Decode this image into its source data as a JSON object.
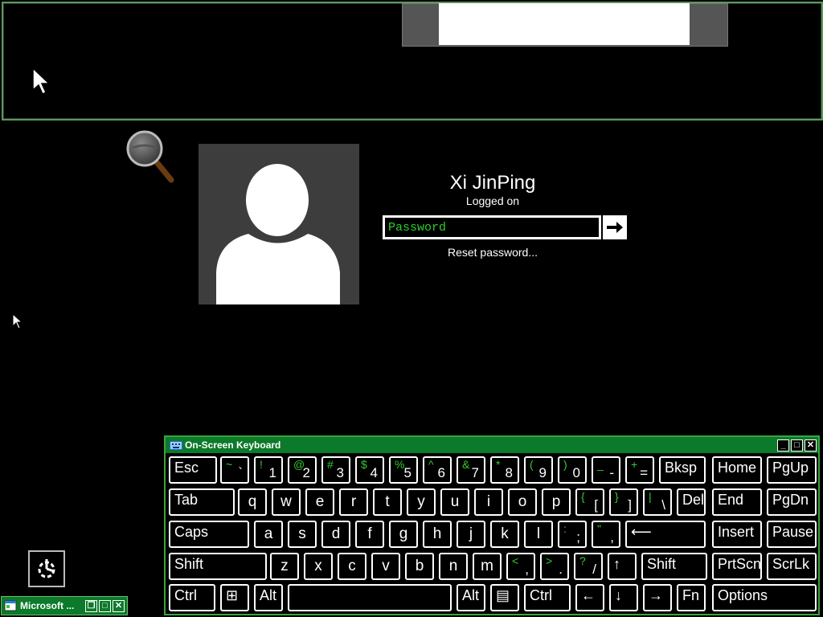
{
  "user": {
    "name": "Xi JinPing",
    "status": "Logged on",
    "password_placeholder": "Password",
    "reset_link": "Reset password..."
  },
  "osk": {
    "title": "On-Screen Keyboard",
    "rows": [
      [
        {
          "id": "esc",
          "label": "Esc"
        },
        {
          "id": "backtick",
          "shift": "~",
          "base": "`"
        },
        {
          "id": "1",
          "shift": "!",
          "base": "1"
        },
        {
          "id": "2",
          "shift": "@",
          "base": "2"
        },
        {
          "id": "3",
          "shift": "#",
          "base": "3"
        },
        {
          "id": "4",
          "shift": "$",
          "base": "4"
        },
        {
          "id": "5",
          "shift": "%",
          "base": "5"
        },
        {
          "id": "6",
          "shift": "^",
          "base": "6"
        },
        {
          "id": "7",
          "shift": "&",
          "base": "7"
        },
        {
          "id": "8",
          "shift": "*",
          "base": "8"
        },
        {
          "id": "9",
          "shift": "(",
          "base": "9"
        },
        {
          "id": "0",
          "shift": ")",
          "base": "0"
        },
        {
          "id": "minus",
          "shift": "_",
          "base": "-"
        },
        {
          "id": "equals",
          "shift": "+",
          "base": "="
        },
        {
          "id": "bksp",
          "label": "Bksp"
        },
        {
          "id": "home",
          "label": "Home"
        },
        {
          "id": "pgup",
          "label": "PgUp"
        }
      ],
      [
        {
          "id": "tab",
          "label": "Tab"
        },
        {
          "id": "q",
          "char": "q"
        },
        {
          "id": "w",
          "char": "w"
        },
        {
          "id": "e",
          "char": "e"
        },
        {
          "id": "r",
          "char": "r"
        },
        {
          "id": "t",
          "char": "t"
        },
        {
          "id": "y",
          "char": "y"
        },
        {
          "id": "u",
          "char": "u"
        },
        {
          "id": "i",
          "char": "i"
        },
        {
          "id": "o",
          "char": "o"
        },
        {
          "id": "p",
          "char": "p"
        },
        {
          "id": "lbracket",
          "shift": "{",
          "base": "["
        },
        {
          "id": "rbracket",
          "shift": "}",
          "base": "]"
        },
        {
          "id": "backslash",
          "shift": "|",
          "base": "\\"
        },
        {
          "id": "del",
          "label": "Del"
        },
        {
          "id": "end",
          "label": "End"
        },
        {
          "id": "pgdn",
          "label": "PgDn"
        }
      ],
      [
        {
          "id": "caps",
          "label": "Caps"
        },
        {
          "id": "a",
          "char": "a"
        },
        {
          "id": "s",
          "char": "s"
        },
        {
          "id": "d",
          "char": "d"
        },
        {
          "id": "f",
          "char": "f"
        },
        {
          "id": "g",
          "char": "g"
        },
        {
          "id": "h",
          "char": "h"
        },
        {
          "id": "j",
          "char": "j"
        },
        {
          "id": "k",
          "char": "k"
        },
        {
          "id": "l",
          "char": "l"
        },
        {
          "id": "semicolon",
          "shift": ":",
          "base": ";"
        },
        {
          "id": "quote",
          "shift": "\"",
          "base": ","
        },
        {
          "id": "enter",
          "label": "⟵"
        },
        {
          "id": "insert",
          "label": "Insert"
        },
        {
          "id": "pause",
          "label": "Pause"
        }
      ],
      [
        {
          "id": "lshift",
          "label": "Shift"
        },
        {
          "id": "z",
          "char": "z"
        },
        {
          "id": "x",
          "char": "x"
        },
        {
          "id": "c",
          "char": "c"
        },
        {
          "id": "v",
          "char": "v"
        },
        {
          "id": "b",
          "char": "b"
        },
        {
          "id": "n",
          "char": "n"
        },
        {
          "id": "m",
          "char": "m"
        },
        {
          "id": "comma",
          "shift": "<",
          "base": ","
        },
        {
          "id": "period",
          "shift": ">",
          "base": "."
        },
        {
          "id": "slash",
          "shift": "?",
          "base": "/"
        },
        {
          "id": "up",
          "label": "↑"
        },
        {
          "id": "rshift",
          "label": "Shift"
        },
        {
          "id": "prtscn",
          "label": "PrtScn"
        },
        {
          "id": "scrlk",
          "label": "ScrLk"
        }
      ],
      [
        {
          "id": "ctrl",
          "label": "Ctrl"
        },
        {
          "id": "win",
          "label": "⊞"
        },
        {
          "id": "alt",
          "label": "Alt"
        },
        {
          "id": "space",
          "label": ""
        },
        {
          "id": "altgr",
          "label": "Alt"
        },
        {
          "id": "menu",
          "label": "▤"
        },
        {
          "id": "rctrl",
          "label": "Ctrl"
        },
        {
          "id": "left",
          "label": "←"
        },
        {
          "id": "down",
          "label": "↓"
        },
        {
          "id": "right",
          "label": "→"
        },
        {
          "id": "fn",
          "label": "Fn"
        },
        {
          "id": "options",
          "label": "Options"
        }
      ]
    ]
  },
  "taskbar": {
    "app_label": "Microsoft ..."
  },
  "colors": {
    "accent_green": "#0b7a2a",
    "key_shift_green": "#2ecc2e"
  }
}
